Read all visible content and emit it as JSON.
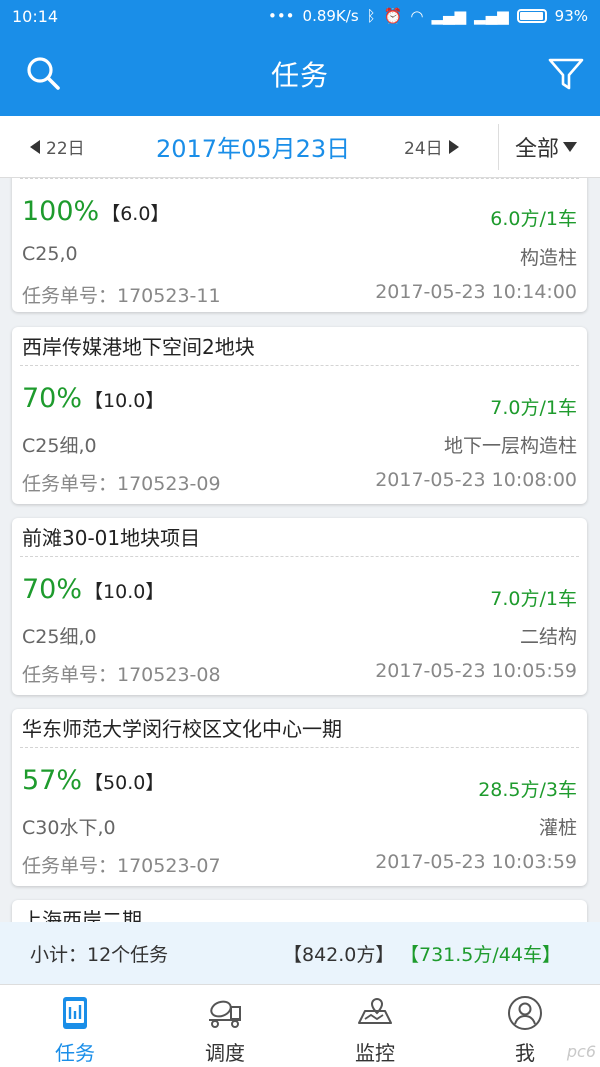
{
  "statusbar": {
    "time": "10:14",
    "speed": "0.89K/s",
    "battery": "93%"
  },
  "header": {
    "title": "任务"
  },
  "datebar": {
    "prev": "22日",
    "current": "2017年05月23日",
    "next": "24日",
    "filter": "全部"
  },
  "tasks": [
    {
      "project": "",
      "percent": "100%",
      "quantity": "【6.0】",
      "volume": "6.0方/1车",
      "grade": "C25,0",
      "part": "构造柱",
      "task_no": "任务单号：170523-11",
      "time": "2017-05-23 10:14:00"
    },
    {
      "project": "西岸传媒港地下空间2地块",
      "percent": "70%",
      "quantity": "【10.0】",
      "volume": "7.0方/1车",
      "grade": "C25细,0",
      "part": "地下一层构造柱",
      "task_no": "任务单号：170523-09",
      "time": "2017-05-23 10:08:00"
    },
    {
      "project": "前滩30-01地块项目",
      "percent": "70%",
      "quantity": "【10.0】",
      "volume": "7.0方/1车",
      "grade": "C25细,0",
      "part": "二结构",
      "task_no": "任务单号：170523-08",
      "time": "2017-05-23 10:05:59"
    },
    {
      "project": "华东师范大学闵行校区文化中心一期",
      "percent": "57%",
      "quantity": "【50.0】",
      "volume": "28.5方/3车",
      "grade": "C30水下,0",
      "part": "灌桩",
      "task_no": "任务单号：170523-07",
      "time": "2017-05-23 10:03:59"
    },
    {
      "project": "上海西岸二期",
      "percent": "",
      "quantity": "",
      "volume": "",
      "grade": "",
      "part": "",
      "task_no": "",
      "time": ""
    }
  ],
  "summary": {
    "label": "小计：12个任务",
    "total": "【842.0方】",
    "done": "【731.5方/44车】"
  },
  "nav": [
    {
      "label": "任务",
      "icon": "task-icon"
    },
    {
      "label": "调度",
      "icon": "mixer-truck-icon"
    },
    {
      "label": "监控",
      "icon": "map-icon"
    },
    {
      "label": "我",
      "icon": "user-icon"
    }
  ],
  "colors": {
    "primary": "#1a8ee8",
    "green": "#1e9b2d"
  },
  "watermark": "pc6"
}
